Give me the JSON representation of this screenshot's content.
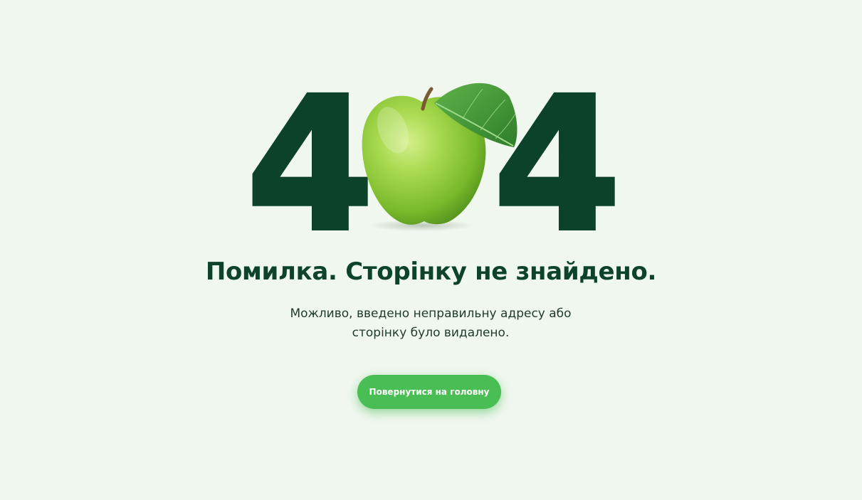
{
  "hero": {
    "digit_left": "4",
    "digit_right": "4",
    "apple_icon": "green-apple-with-leaf-icon"
  },
  "colors": {
    "background": "#f0f7ef",
    "digits": "#0b4229",
    "title": "#0d4429",
    "accent_button": "#49be55"
  },
  "error": {
    "title": "Помилка. Сторінку не знайдено.",
    "description_line1": "Можливо, введено неправильну адресу або",
    "description_line2": "сторінку було видалено."
  },
  "actions": {
    "home_button_label": "Повернутися на головну"
  }
}
